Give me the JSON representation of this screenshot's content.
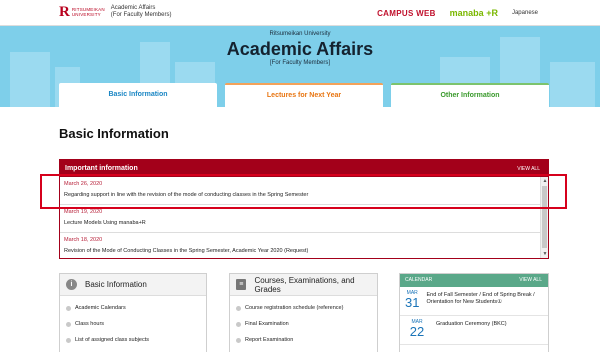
{
  "header": {
    "logo_mark": "R",
    "logo_line1": "RITSUMEIKAN",
    "logo_line2": "UNIVERSITY",
    "site_title_1": "Academic Affairs",
    "site_title_2": "(For Faculty Members)",
    "campus_web": "CAMPUS WEB",
    "manaba": "manaba",
    "manaba_plus": "+R",
    "language": "Japanese"
  },
  "hero": {
    "university": "Ritsumeikan University",
    "title": "Academic Affairs",
    "subtitle": "[For Faculty Members]"
  },
  "tabs": [
    "Basic Information",
    "Lectures for Next Year",
    "Other Information"
  ],
  "page_title": "Basic Information",
  "important": {
    "heading": "Important information",
    "view_all": "VIEW ALL",
    "items": [
      {
        "date": "March 26, 2020",
        "text": "Regarding support in line with the revision of the mode of conducting classes in the Spring Semester"
      },
      {
        "date": "March 19, 2020",
        "text": "Lecture Models Using manaba+R"
      },
      {
        "date": "March 18, 2020",
        "text": "Revision of the Mode of Conducting Classes in the Spring Semester, Academic Year 2020 (Request)"
      }
    ]
  },
  "panel_basic": {
    "title": "Basic Information",
    "items": [
      "Academic Calendars",
      "Class hours",
      "List of assigned class subjects"
    ]
  },
  "panel_courses": {
    "title": "Courses, Examinations, and Grades",
    "items": [
      "Course registration schedule (reference)",
      "Final Examination",
      "Report Examination"
    ]
  },
  "calendar": {
    "heading": "CALENDAR",
    "view_all": "VIEW ALL",
    "items": [
      {
        "month": "MAR",
        "day": "31",
        "text": "End of Fall Semester / End of Spring Break / Orientation for New Students①"
      },
      {
        "month": "MAR",
        "day": "22",
        "text": "Graduation Ceremony (BKC)"
      }
    ]
  },
  "colors": {
    "brand": "#b8001e",
    "hero": "#7ecfea",
    "info_header": "#a3001a",
    "calendar_header": "#5aa889"
  }
}
